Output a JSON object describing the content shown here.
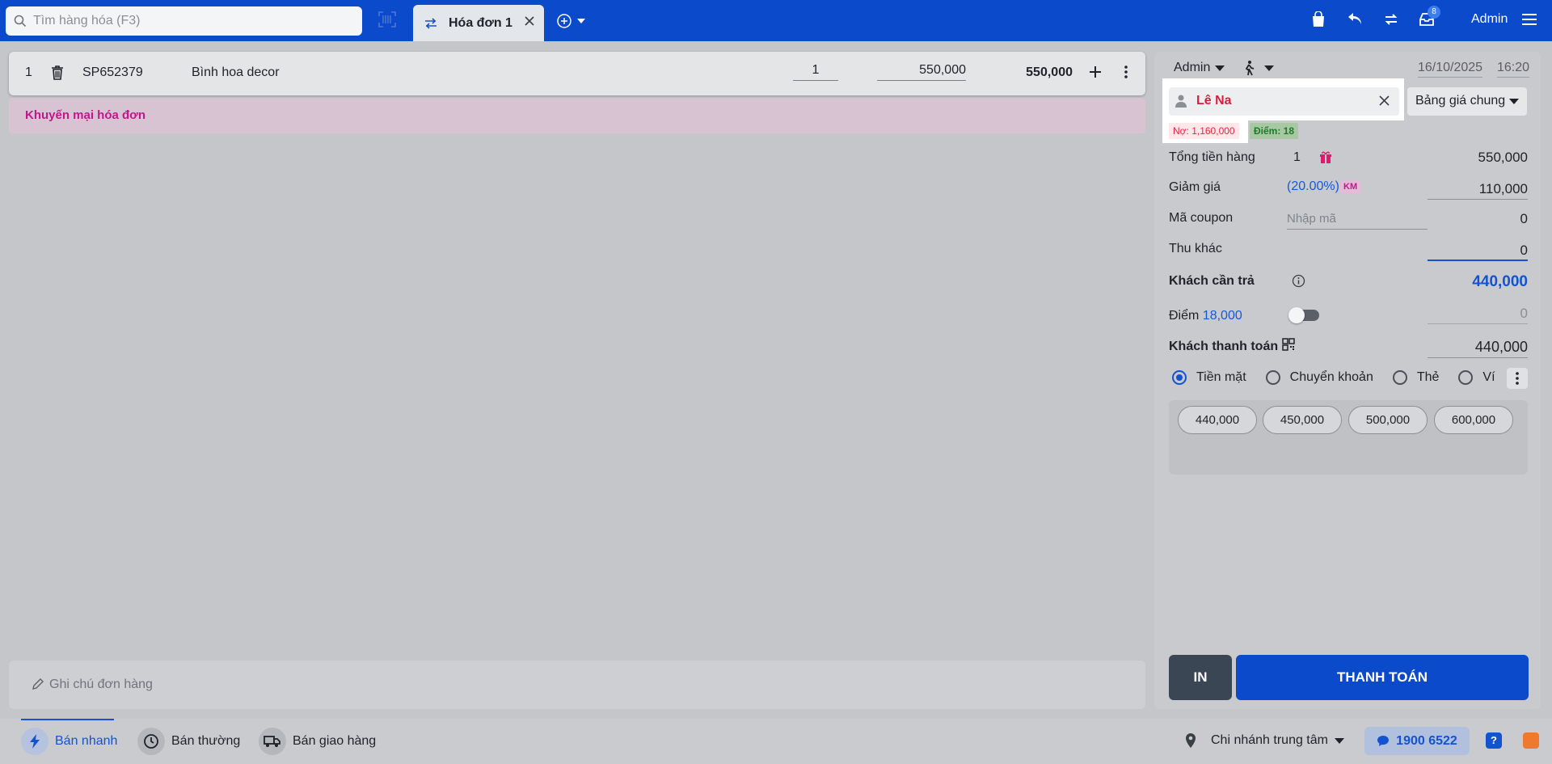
{
  "topbar": {
    "search_placeholder": "Tìm hàng hóa (F3)",
    "tab_label": "Hóa đơn 1",
    "notification_count": "8",
    "user": "Admin"
  },
  "cart": {
    "items": [
      {
        "no": "1",
        "code": "SP652379",
        "name": "Bình hoa decor",
        "qty": "1",
        "price": "550,000",
        "total": "550,000"
      }
    ],
    "promo_label": "Khuyến mại hóa đơn",
    "note_placeholder": "Ghi chú đơn hàng"
  },
  "panel": {
    "seller": "Admin",
    "date": "16/10/2025",
    "time": "16:20",
    "customer_name": "Lê Na",
    "price_book": "Bảng giá chung",
    "debt_tag": "Nợ: 1,160,000",
    "points_tag": "Điểm: 18",
    "subtotal_label": "Tổng tiền hàng",
    "subtotal_count": "1",
    "subtotal_value": "550,000",
    "discount_label": "Giảm giá",
    "discount_pct": "(20.00%)",
    "discount_tag": "KM",
    "discount_value": "110,000",
    "coupon_label": "Mã coupon",
    "coupon_placeholder": "Nhập mã",
    "coupon_value": "0",
    "other_label": "Thu khác",
    "other_value": "0",
    "due_label": "Khách cần trả",
    "due_value": "440,000",
    "points_label": "Điểm",
    "points_value": "18,000",
    "points_input": "0",
    "paid_label": "Khách thanh toán",
    "paid_value": "440,000",
    "payment_methods": [
      "Tiền mặt",
      "Chuyển khoản",
      "Thẻ",
      "Ví"
    ],
    "selected_method": "Tiền mặt",
    "quick_amounts": [
      "440,000",
      "450,000",
      "500,000",
      "600,000"
    ],
    "print_label": "IN",
    "pay_label": "THANH TOÁN"
  },
  "bottombar": {
    "modes": [
      "Bán nhanh",
      "Bán thường",
      "Bán giao hàng"
    ],
    "active_mode": "Bán nhanh",
    "branch": "Chi nhánh trung tâm",
    "hotline": "1900 6522",
    "help": "?"
  },
  "colors": {
    "brand": "#0b4bcb",
    "customer": "#d81e3c",
    "promo": "#c4168c"
  }
}
